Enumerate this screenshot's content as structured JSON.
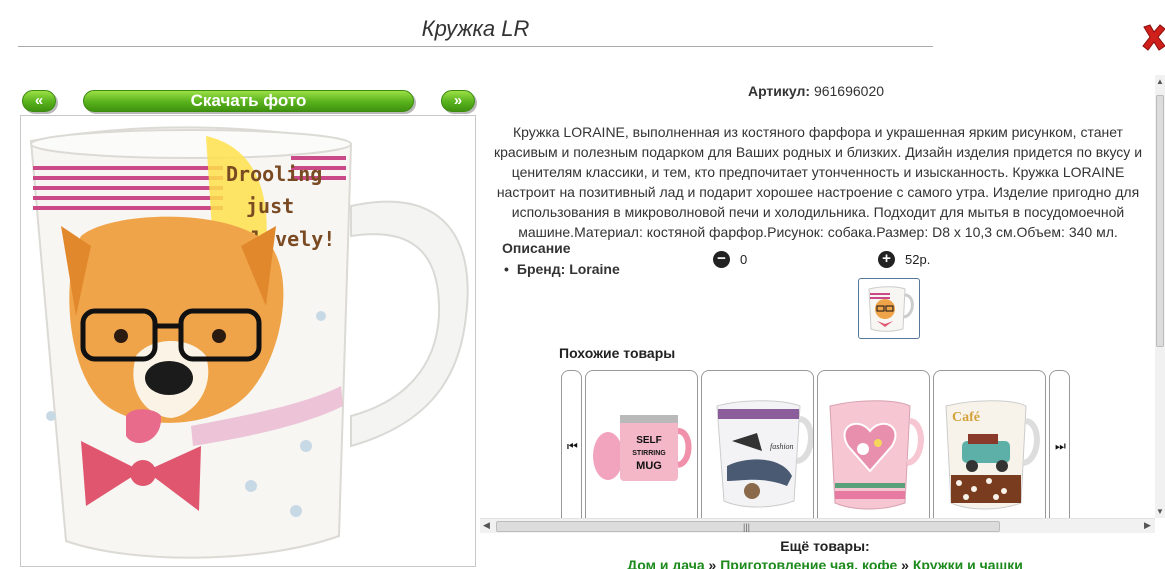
{
  "header": {
    "title": "Кружка LR"
  },
  "gallery": {
    "prev_label": "«",
    "download_label": "Скачать фото",
    "next_label": "»",
    "mug_text_line1": "Drooling",
    "mug_text_line2": "just",
    "mug_text_line3": "lovely!"
  },
  "product": {
    "article_label": "Артикул:",
    "article_value": "961696020",
    "description": "Кружка LORAINE, выполненная из костяного фарфора и украшенная ярким рисунком, станет красивым и полезным подарком для Ваших родных и близких. Дизайн изделия придется по вкусу и ценителям классики, и тем, кто предпочитает утонченность и изысканность. Кружка LORAINE настроит на позитивный лад и подарит хорошее настроение с самого утра. Изделие пригодно для использования в микроволновой печи и холодильника. Подходит для мытья в посудомоечной машине.Материал: костяной фарфор.Рисунок: собака.Размер: D8 х 10,3 см.Объем: 340 мл.",
    "spec_heading": "Описание",
    "spec_brand": "Бренд: Loraine",
    "quantity": "0",
    "price": "52р.",
    "minus_symbol": "−",
    "plus_symbol": "+"
  },
  "similar": {
    "title": "Похожие товары",
    "items": [
      {
        "name": "self-stirring-mug",
        "text": "SELF STIRRING MUG"
      },
      {
        "name": "fashion-mug",
        "text": "fashion"
      },
      {
        "name": "heart-flower-mug",
        "text": ""
      },
      {
        "name": "car-cafe-mug",
        "text": "Café"
      }
    ]
  },
  "more": {
    "title": "Ещё товары:",
    "breadcrumbs": [
      "Дом и дача",
      "Приготовление чая, кофе",
      "Кружки и чашки"
    ],
    "separator": "»"
  },
  "colors": {
    "accent_green": "#58b21c",
    "link_green": "#1d8a1d",
    "close_red": "#d0201c"
  }
}
